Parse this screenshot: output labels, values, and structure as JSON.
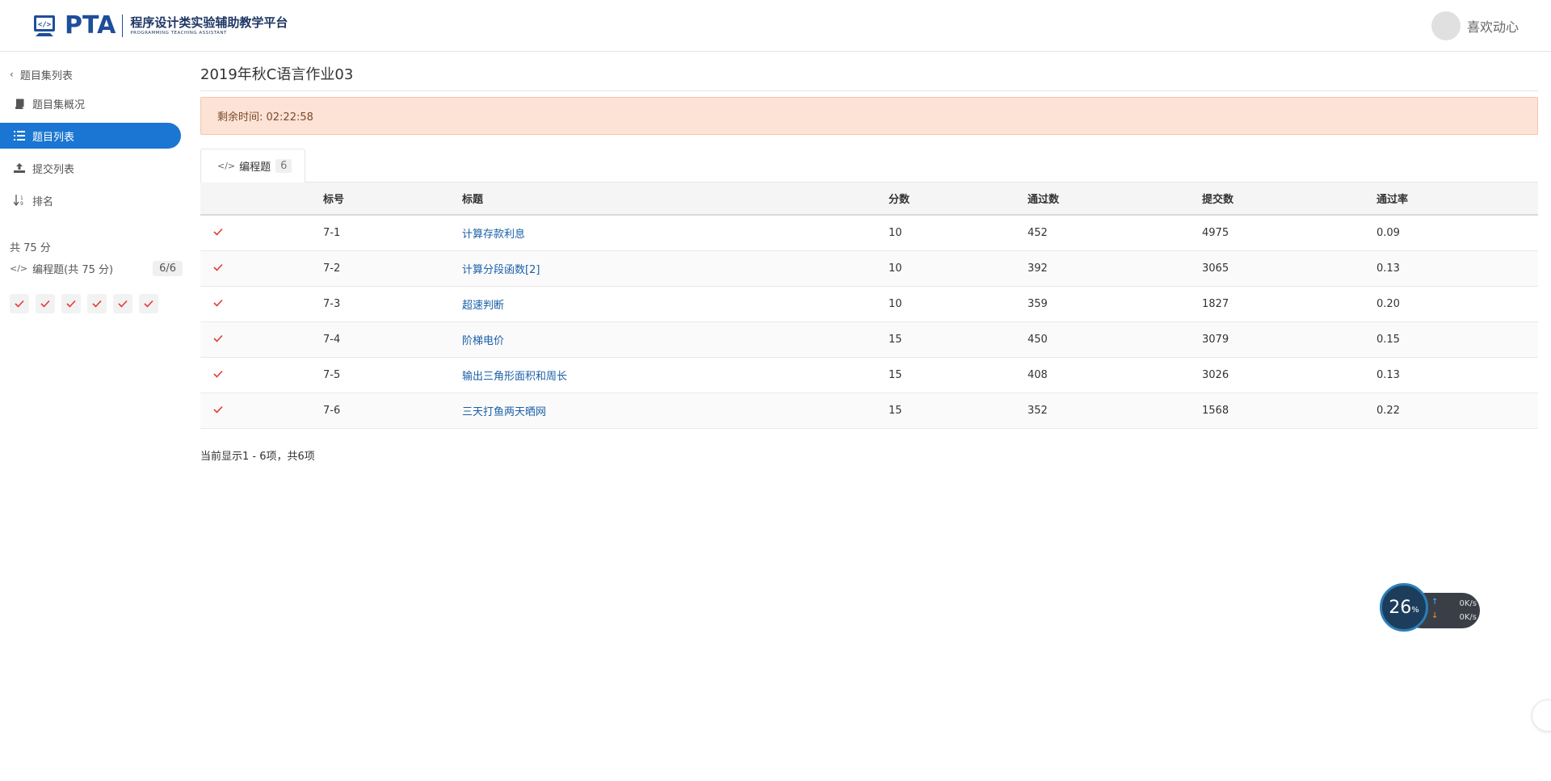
{
  "header": {
    "logo_text": "PTA",
    "logo_cn": "程序设计类实验辅助教学平台",
    "logo_en": "PROGRAMMING TEACHING ASSISTANT",
    "username": "喜欢动心"
  },
  "sidebar": {
    "back_label": "题目集列表",
    "items": [
      {
        "label": "题目集概况",
        "icon": "book-icon"
      },
      {
        "label": "题目列表",
        "icon": "list-icon",
        "active": true
      },
      {
        "label": "提交列表",
        "icon": "upload-icon"
      },
      {
        "label": "排名",
        "icon": "sort-icon"
      }
    ],
    "total": "共 75 分",
    "category_label": "编程题(共 75 分)",
    "category_count": "6/6"
  },
  "main": {
    "title": "2019年秋C语言作业03",
    "timer": "剩余时间: 02:22:58",
    "tab_label": "编程题",
    "tab_count": "6",
    "columns": [
      "标号",
      "标题",
      "分数",
      "通过数",
      "提交数",
      "通过率"
    ],
    "rows": [
      {
        "id": "7-1",
        "title": "计算存款利息",
        "score": "10",
        "passed": "452",
        "submitted": "4975",
        "rate": "0.09"
      },
      {
        "id": "7-2",
        "title": "计算分段函数[2]",
        "score": "10",
        "passed": "392",
        "submitted": "3065",
        "rate": "0.13"
      },
      {
        "id": "7-3",
        "title": "超速判断",
        "score": "10",
        "passed": "359",
        "submitted": "1827",
        "rate": "0.20"
      },
      {
        "id": "7-4",
        "title": "阶梯电价",
        "score": "15",
        "passed": "450",
        "submitted": "3079",
        "rate": "0.15"
      },
      {
        "id": "7-5",
        "title": "输出三角形面积和周长",
        "score": "15",
        "passed": "408",
        "submitted": "3026",
        "rate": "0.13"
      },
      {
        "id": "7-6",
        "title": "三天打鱼两天晒网",
        "score": "15",
        "passed": "352",
        "submitted": "1568",
        "rate": "0.22"
      }
    ],
    "footer": "当前显示1 - 6项，共6项"
  },
  "speed_widget": {
    "percent": "26",
    "percent_unit": "%",
    "up": "0K/s",
    "down": "0K/s"
  },
  "colors": {
    "accent": "#1a76d2",
    "brand": "#1f4e9a",
    "check": "#e53935",
    "timer_bg": "#fde2d6"
  }
}
